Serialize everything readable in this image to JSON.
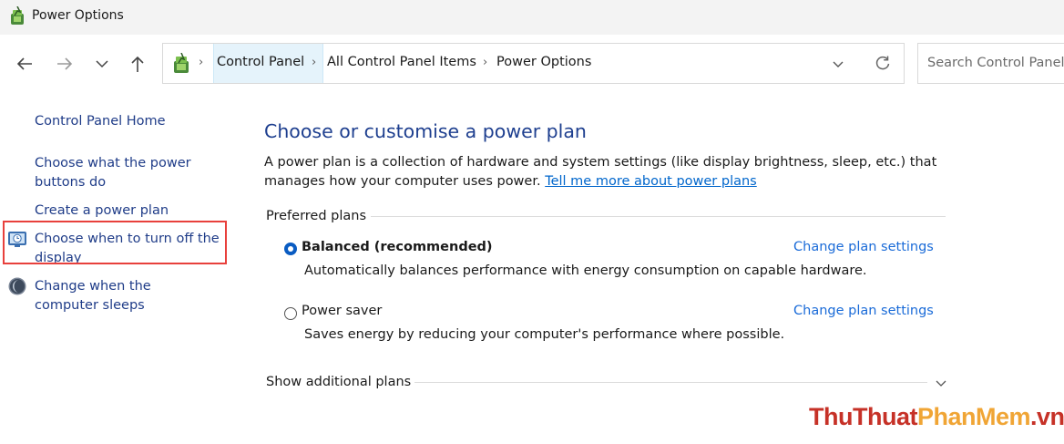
{
  "window": {
    "title": "Power Options"
  },
  "nav": {
    "back_icon": "arrow-left-icon",
    "forward_icon": "arrow-right-icon",
    "recent_icon": "chevron-down-icon",
    "up_icon": "arrow-up-icon"
  },
  "address": {
    "breadcrumbs": [
      "Control Panel",
      "All Control Panel Items",
      "Power Options"
    ],
    "separator": "›"
  },
  "search": {
    "placeholder": "Search Control Panel"
  },
  "sidebar": {
    "home": "Control Panel Home",
    "items": [
      {
        "label": "Choose what the power buttons do"
      },
      {
        "label": "Create a power plan"
      },
      {
        "label": "Choose when to turn off the display",
        "icon": "display-clock-icon",
        "highlighted": true
      },
      {
        "label": "Change when the computer sleeps",
        "icon": "moon-icon"
      }
    ]
  },
  "main": {
    "heading": "Choose or customise a power plan",
    "description": "A power plan is a collection of hardware and system settings (like display brightness, sleep, etc.) that manages how your computer uses power.",
    "learn_more_link": "Tell me more about power plans",
    "preferred_label": "Preferred plans",
    "plans": [
      {
        "name": "Balanced (recommended)",
        "selected": true,
        "description": "Automatically balances performance with energy consumption on capable hardware.",
        "link": "Change plan settings"
      },
      {
        "name": "Power saver",
        "selected": false,
        "description": "Saves energy by reducing your computer's performance where possible.",
        "link": "Change plan settings"
      }
    ],
    "additional_label": "Show additional plans"
  },
  "watermark": {
    "part1": "Thu",
    "part2": "Thuat",
    "part3": "PhanMem",
    "part4": ".vn"
  },
  "colors": {
    "accent": "#0a5cc2",
    "link": "#1a6bd8",
    "heading": "#1e3f8f",
    "highlight": "#e8403c"
  }
}
